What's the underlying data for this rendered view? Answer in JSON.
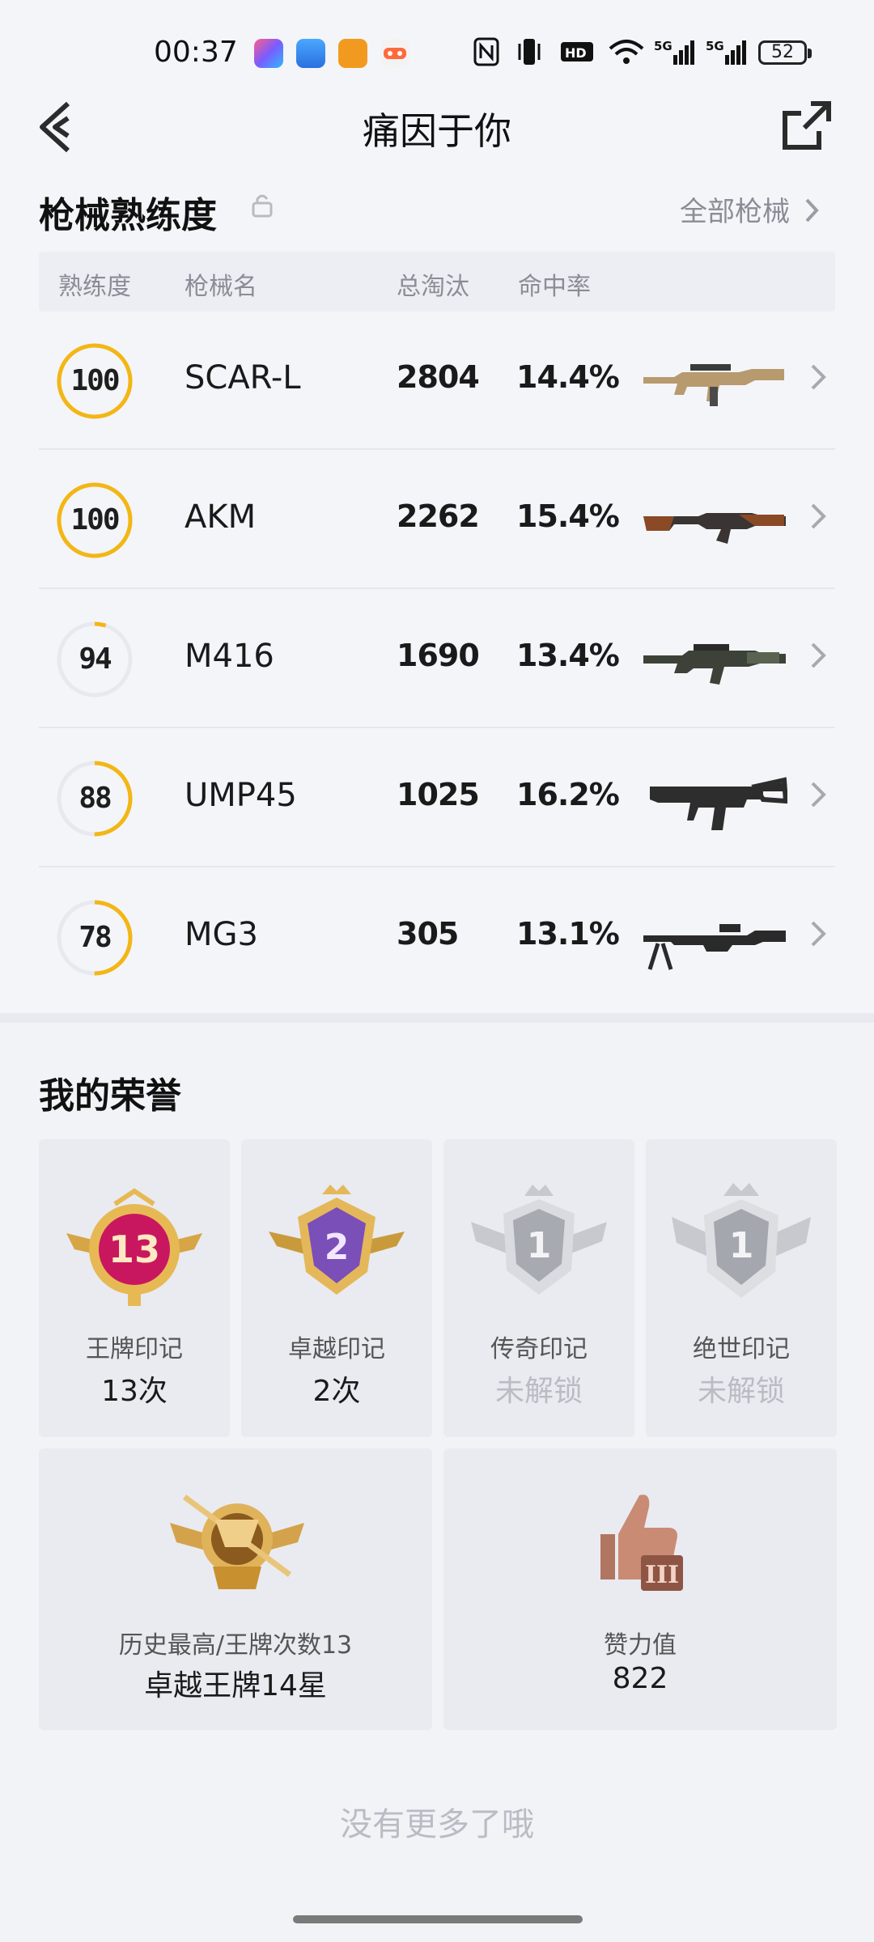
{
  "status_bar": {
    "time": "00:37",
    "battery": "52",
    "icons": [
      "nfc-icon",
      "vibrate-icon",
      "hd-icon",
      "wifi-icon",
      "signal-5g-icon",
      "signal-5g-icon"
    ]
  },
  "nav": {
    "title": "痛因于你"
  },
  "mastery": {
    "title": "枪械熟练度",
    "all_link": "全部枪械",
    "headers": {
      "level": "熟练度",
      "name": "枪械名",
      "kills": "总淘汰",
      "accuracy": "命中率"
    },
    "rows": [
      {
        "level": "100",
        "fraction": 1.0,
        "name": "SCAR-L",
        "kills": "2804",
        "accuracy": "14.4%"
      },
      {
        "level": "100",
        "fraction": 1.0,
        "name": "AKM",
        "kills": "2262",
        "accuracy": "15.4%"
      },
      {
        "level": "94",
        "fraction": 0.05,
        "name": "M416",
        "kills": "1690",
        "accuracy": "13.4%"
      },
      {
        "level": "88",
        "fraction": 0.5,
        "name": "UMP45",
        "kills": "1025",
        "accuracy": "16.2%"
      },
      {
        "level": "78",
        "fraction": 0.5,
        "name": "MG3",
        "kills": "305",
        "accuracy": "13.1%"
      }
    ],
    "ring_color": "#f3b614"
  },
  "honors": {
    "title": "我的荣誉",
    "cards": [
      {
        "badge_text": "13",
        "label": "王牌印记",
        "value": "13次",
        "locked": false
      },
      {
        "badge_text": "2",
        "label": "卓越印记",
        "value": "2次",
        "locked": false
      },
      {
        "badge_text": "1",
        "label": "传奇印记",
        "value": "未解锁",
        "locked": true
      },
      {
        "badge_text": "1",
        "label": "绝世印记",
        "value": "未解锁",
        "locked": true
      }
    ],
    "wide_cards": [
      {
        "label": "历史最高/王牌次数13",
        "value": "卓越王牌14星"
      },
      {
        "label": "赞力值",
        "value": "822"
      }
    ]
  },
  "footer": {
    "text": "没有更多了哦"
  }
}
